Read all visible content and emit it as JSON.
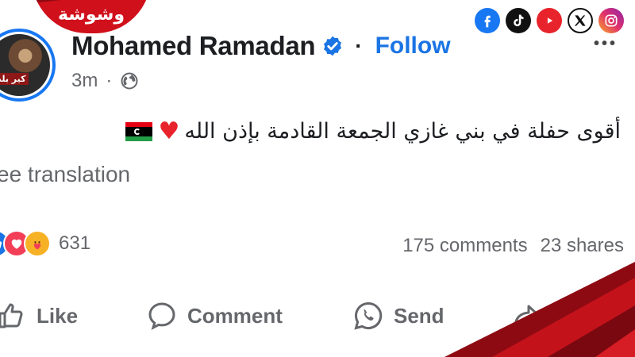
{
  "brand": {
    "text": "وشوشة"
  },
  "socials": [
    {
      "name": "facebook",
      "color": "#1877f2"
    },
    {
      "name": "tiktok",
      "color": "#000000"
    },
    {
      "name": "youtube",
      "color": "#ff0000"
    },
    {
      "name": "x",
      "color": "#000000"
    },
    {
      "name": "instagram",
      "color": "#e1306c"
    }
  ],
  "post": {
    "author": "Mohamed Ramadan",
    "verified": true,
    "follow_label": "Follow",
    "time": "3m",
    "audience_icon": "globe-icon",
    "avatar_label": "كير بلد",
    "text": "أقوى حفلة في بني غازي الجمعة القادمة بإذن الله",
    "translate_label": "ee translation"
  },
  "reactions": {
    "types": [
      "like",
      "love",
      "care"
    ],
    "count": "631"
  },
  "stats": {
    "comments": "175 comments",
    "shares": "23 shares"
  },
  "actions": {
    "like": "Like",
    "comment": "Comment",
    "send": "Send",
    "share": "Sha"
  },
  "colors": {
    "accent": "#1b74e4",
    "muted": "#65676b",
    "brand_red": "#d0101b"
  }
}
